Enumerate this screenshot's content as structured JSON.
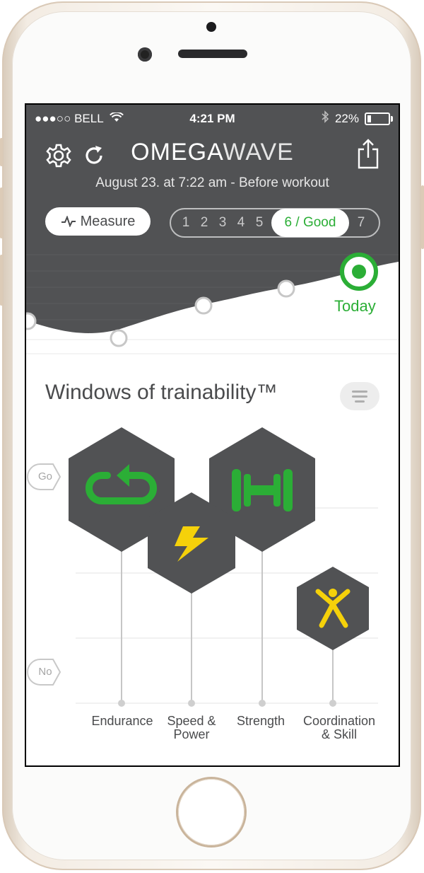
{
  "status_bar": {
    "carrier": "●●●○○ BELL",
    "time": "4:21 PM",
    "battery": "22%",
    "battery_level": 0.22
  },
  "header": {
    "logo_part1": "OMEGA",
    "logo_part2": "WAVE",
    "subtitle": "August 23. at 7:22 am - Before workout",
    "measure_label": "Measure",
    "scale_items": [
      "1",
      "2",
      "3",
      "4",
      "5"
    ],
    "scale_selected": "6 / Good",
    "scale_last": "7",
    "today_label": "Today"
  },
  "readiness_trend": {
    "points": [
      3.0,
      2.0,
      4.0,
      5.0,
      6.0
    ],
    "colors": {
      "bg": "#515254",
      "accent": "#2bae36"
    }
  },
  "trainability": {
    "title": "Windows of trainability™",
    "go_label": "Go",
    "no_label": "No",
    "categories": [
      {
        "label_line1": "Endurance",
        "label_line2": "",
        "icon": "loop-arrow-icon",
        "level": 0.98,
        "color": "#2bae36"
      },
      {
        "label_line1": "Speed &",
        "label_line2": "Power",
        "icon": "lightning-icon",
        "level": 0.62,
        "color": "#f5d10a"
      },
      {
        "label_line1": "Strength",
        "label_line2": "",
        "icon": "dumbbell-icon",
        "level": 0.98,
        "color": "#2bae36"
      },
      {
        "label_line1": "Coordination",
        "label_line2": "& Skill",
        "icon": "person-figure-icon",
        "level": 0.38,
        "color": "#f5d10a"
      }
    ]
  },
  "colors": {
    "header_bg": "#515254",
    "hex_fill": "#515254",
    "green": "#2bae36",
    "yellow": "#f5d10a",
    "text_dark": "#4a4b4d"
  }
}
